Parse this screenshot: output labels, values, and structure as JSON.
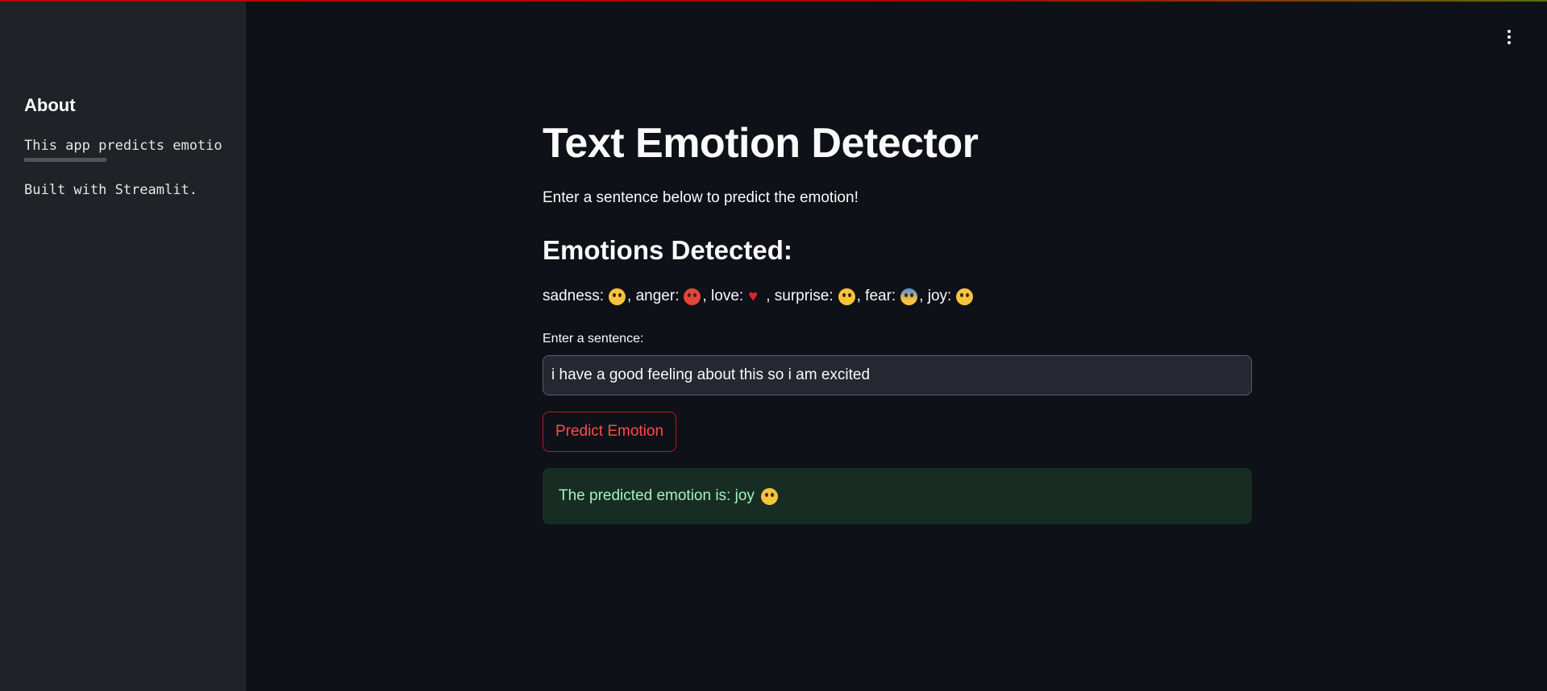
{
  "sidebar": {
    "title": "About",
    "line1": "This app predicts emotions",
    "line2": "Built with Streamlit."
  },
  "main": {
    "title": "Text Emotion Detector",
    "intro": "Enter a sentence below to predict the emotion!",
    "subheader": "Emotions Detected:",
    "emotions": [
      {
        "label": "sadness:",
        "sep": ","
      },
      {
        "label": "anger:",
        "sep": ","
      },
      {
        "label": "love:",
        "sep": ","
      },
      {
        "label": "surprise:",
        "sep": ","
      },
      {
        "label": "fear:",
        "sep": ","
      },
      {
        "label": "joy:",
        "sep": ""
      }
    ],
    "input_label": "Enter a sentence:",
    "input_value": "i have a good feeling about this so i am excited",
    "button_label": "Predict Emotion",
    "result_text": "The predicted emotion is: joy"
  },
  "colors": {
    "background": "#0e1117",
    "sidebar": "#1f2226",
    "accent": "#ff4b4b",
    "success_bg": "#172d24",
    "success_text": "#a6f0bf"
  },
  "icons": [
    "flushed-face-icon",
    "angry-face-icon",
    "red-heart-icon",
    "astonished-face-icon",
    "fearful-face-icon",
    "smiling-face-icon",
    "kebab-menu-icon"
  ]
}
